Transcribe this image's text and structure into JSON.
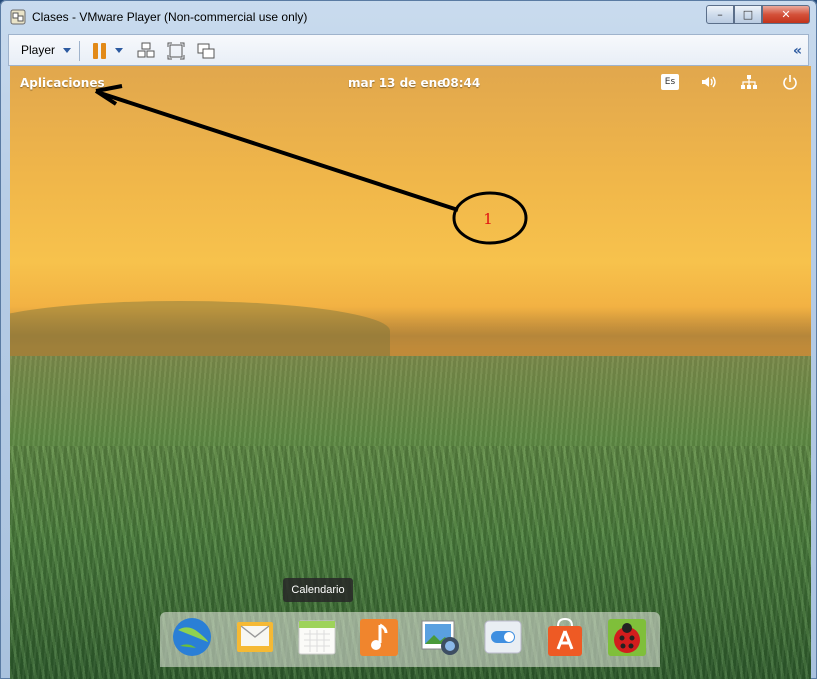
{
  "window": {
    "title": "Clases - VMware Player (Non-commercial use only)",
    "min_label": "–",
    "max_label": "□",
    "close_label": "✕"
  },
  "toolbar": {
    "player_label": "Player",
    "collapse_label": "«"
  },
  "guest": {
    "panel": {
      "apps_label": "Aplicaciones",
      "date": "mar 13 de ene",
      "time": "08:44",
      "keyboard_layout": "Es"
    },
    "annotation": {
      "label": "1",
      "color": "#e01010"
    },
    "dock": {
      "tooltip": "Calendario",
      "items": [
        {
          "name": "Navegador"
        },
        {
          "name": "Correo"
        },
        {
          "name": "Calendario"
        },
        {
          "name": "Música"
        },
        {
          "name": "Fotos"
        },
        {
          "name": "Configuración"
        },
        {
          "name": "Centro de aplicaciones"
        },
        {
          "name": "Informe de errores"
        }
      ]
    }
  },
  "colors": {
    "accent": "#2c5aa0",
    "pause": "#e28a18",
    "close": "#c2331b"
  }
}
